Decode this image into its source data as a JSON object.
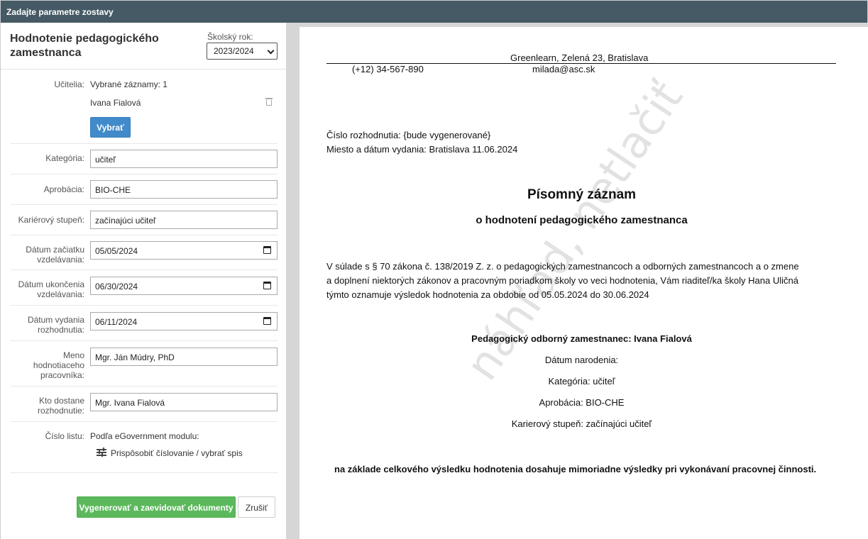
{
  "window": {
    "title": "Zadajte parametre zostavy"
  },
  "panel": {
    "title": "Hodnotenie pedagogického zamestnanca",
    "school_year_label": "Školský rok:",
    "school_year_value": "2023/2024"
  },
  "form": {
    "teachers_label": "Učitelia:",
    "selected_records": "Vybrané záznamy: 1",
    "teacher_name": "Ivana Fialová",
    "select_button": "Vybrať",
    "category_label": "Kategória:",
    "category_value": "učiteľ",
    "approbation_label": "Aprobácia:",
    "approbation_value": "BIO-CHE",
    "career_label": "Kariérový stupeň:",
    "career_value": "začínajúci učiteľ",
    "start_date_label": "Dátum začiatku vzdelávania:",
    "start_date_value": "05/05/2024",
    "end_date_label": "Dátum ukončenia vzdelávania:",
    "end_date_value": "06/30/2024",
    "issue_date_label": "Dátum vydania rozhodnutia:",
    "issue_date_value": "06/11/2024",
    "evaluator_label": "Meno hodnotiaceho pracovníka:",
    "evaluator_value": "Mgr. Ján Múdry, PhD",
    "recipient_label": "Kto dostane rozhodnutie:",
    "recipient_value": "Mgr. Ivana Fialová",
    "sheet_number_label": "Číslo listu:",
    "sheet_number_value": "Podľa eGovernment modulu:",
    "numbering_link": "Prispôsobiť číslovanie / vybrať spis",
    "generate_button": "Vygenerovať a zaevidovať dokumenty",
    "cancel_button": "Zrušiť"
  },
  "preview": {
    "address": "Greenlearn, Zelená 23, Bratislava",
    "phone": "(+12) 34-567-890",
    "email": "milada@asc.sk",
    "decision_number": "Číslo rozhodnutia: {bude vygenerované}",
    "place_date": "Miesto a dátum vydania: Bratislava 11.06.2024",
    "heading": "Písomný záznam",
    "subheading": "o hodnotení pedagogického zamestnanca",
    "body_line1": "V súlade s § 70 zákona č. 138/2019 Z. z. o pedagogických zamestnancoch a odborných zamestnancoch a o zmene",
    "body_line2": "a doplnení niektorých zákonov a pracovným poriadkom školy vo veci hodnotenia, Vám riaditeľ/ka školy Hana Uličná",
    "body_line3": "týmto oznamuje výsledok hodnotenia za obdobie od 05.05.2024 do 30.06.2024",
    "employee": "Pedagogický odborný zamestnanec: Ivana Fialová",
    "birth_date": "Dátum narodenia:",
    "category": "Kategória: učiteľ",
    "approbation": "Aprobácia: BIO-CHE",
    "career": "Karierový stupeň: začínajúci učiteľ",
    "result": "na základe celkového výsledku hodnotenia dosahuje mimoriadne výsledky pri vykonávaní pracovnej činnosti.",
    "watermark": "náhľad, netlačiť"
  }
}
